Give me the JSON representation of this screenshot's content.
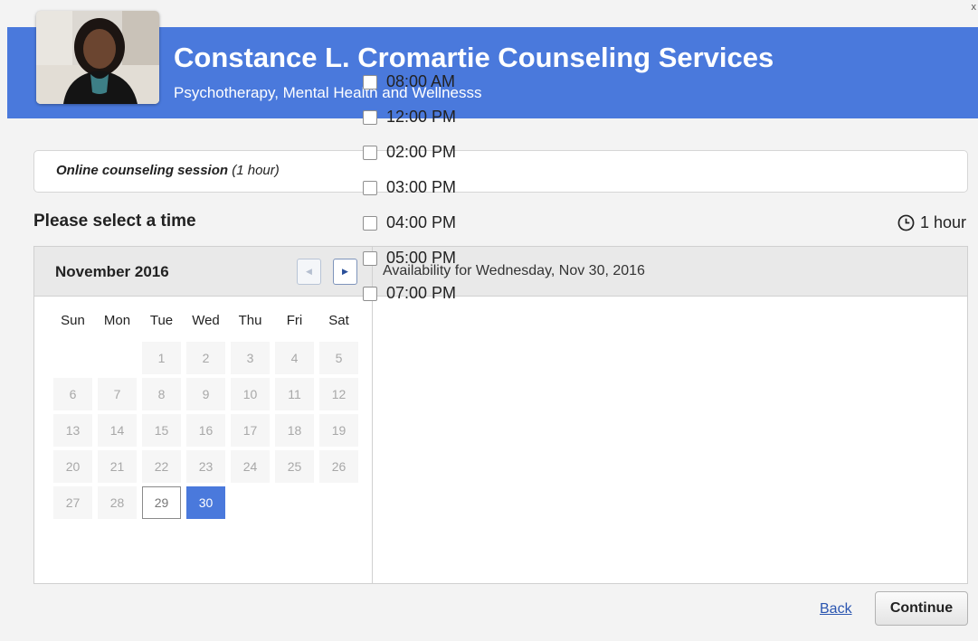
{
  "window": {
    "close_glyph": "x"
  },
  "header": {
    "title": "Constance L. Cromartie Counseling Services",
    "subtitle": "Psychotherapy, Mental Health and Wellnesss",
    "brand_color": "#4a79dc"
  },
  "service": {
    "name": "Online counseling session",
    "duration_note": "(1 hour)"
  },
  "schedule": {
    "heading": "Please select a time",
    "duration_label": "1 hour",
    "duration_icon": "clock-icon"
  },
  "calendar": {
    "month_label": "November 2016",
    "prev_icon": "chevron-left-icon",
    "next_icon": "chevron-right-icon",
    "weekdays": [
      "Sun",
      "Mon",
      "Tue",
      "Wed",
      "Thu",
      "Fri",
      "Sat"
    ],
    "weeks": [
      [
        "",
        "",
        "1",
        "2",
        "3",
        "4",
        "5"
      ],
      [
        "6",
        "7",
        "8",
        "9",
        "10",
        "11",
        "12"
      ],
      [
        "13",
        "14",
        "15",
        "16",
        "17",
        "18",
        "19"
      ],
      [
        "20",
        "21",
        "22",
        "23",
        "24",
        "25",
        "26"
      ],
      [
        "27",
        "28",
        "29",
        "30",
        "",
        "",
        ""
      ]
    ],
    "today": "29",
    "selected": "30"
  },
  "availability": {
    "heading": "Availability for Wednesday, Nov 30, 2016",
    "slots": [
      "08:00 AM",
      "12:00 PM",
      "02:00 PM",
      "03:00 PM",
      "04:00 PM",
      "05:00 PM",
      "07:00 PM"
    ]
  },
  "actions": {
    "back_label": "Back",
    "continue_label": "Continue"
  }
}
